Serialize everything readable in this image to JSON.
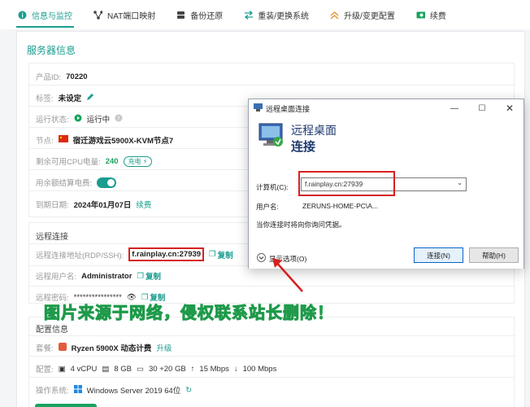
{
  "nav": {
    "tabs": [
      {
        "label": "信息与监控",
        "icon": "info-icon",
        "active": true
      },
      {
        "label": "NAT端口映射",
        "icon": "network-icon"
      },
      {
        "label": "备份还原",
        "icon": "database-icon"
      },
      {
        "label": "重装/更换系统",
        "icon": "swap-icon"
      },
      {
        "label": "升级/变更配置",
        "icon": "upgrade-icon"
      },
      {
        "label": "续费",
        "icon": "money-icon"
      }
    ]
  },
  "server": {
    "title": "服务器信息",
    "product_id_label": "产品ID:",
    "product_id": "70220",
    "tag_label": "标签:",
    "tag_value": "未设定",
    "status_label": "运行状态:",
    "status_value": "运行中",
    "node_label": "节点:",
    "node_value": "宿迁游戏云5900X-KVM节点7",
    "cpu_label": "剩余可用CPU电量:",
    "cpu_value": "240",
    "cpu_badge": "充电",
    "balance_label": "用余额结算电费:",
    "expire_label": "到期日期:",
    "expire_value": "2024年01月07日",
    "renew_link": "续费"
  },
  "remote": {
    "title": "远程连接",
    "addr_label": "远程连接地址(RDP/SSH):",
    "addr_value": "f.rainplay.cn:27939",
    "copy_label": "复制",
    "user_label": "远程用户名:",
    "user_value": "Administrator",
    "pwd_label": "远程密码:",
    "pwd_value": "****************"
  },
  "config": {
    "title": "配置信息",
    "plan_label": "套餐:",
    "plan_value": "Ryzen 5900X 动态计费",
    "upgrade_link": "升级",
    "spec_label": "配置:",
    "cpu": "4 vCPU",
    "ram": "8 GB",
    "disk": "30 +20 GB",
    "up": "15 Mbps",
    "down": "100 Mbps",
    "os_label": "操作系统:",
    "os_value": "Windows Server 2019 64位"
  },
  "dialog": {
    "window_title": "远程桌面连接",
    "head_line1": "远程桌面",
    "head_line2": "连接",
    "computer_label": "计算机(C):",
    "computer_value": "f.rainplay.cn:27939",
    "username_label": "用户名:",
    "username_value": "ZERUNS-HOME-PC\\A...",
    "hint": "当你连接时将向你询问凭据。",
    "show_options": "显示选项(O)",
    "connect_btn": "连接(N)",
    "help_btn": "帮助(H)"
  },
  "watermark": "图片来源于网络，侵权联系站长删除！",
  "colors": {
    "accent": "#1a9d8f",
    "highlight": "#d62020",
    "watermark": "#5ee08b"
  }
}
